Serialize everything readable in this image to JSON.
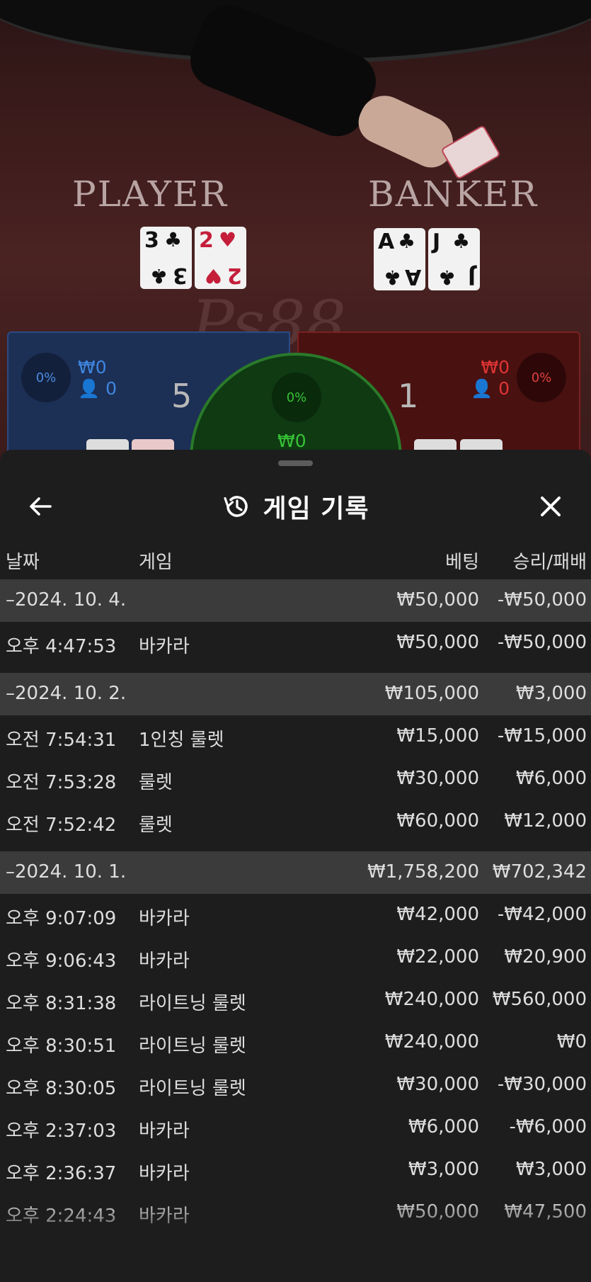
{
  "game_view": {
    "player_label": "PLAYER",
    "banker_label": "BANKER",
    "watermark": "Ps88",
    "player_cards": [
      {
        "rank": "3",
        "suit": "♣",
        "color": "black"
      },
      {
        "rank": "2",
        "suit": "♥",
        "color": "red"
      }
    ],
    "banker_cards": [
      {
        "rank": "A",
        "suit": "♣",
        "color": "black"
      },
      {
        "rank": "J",
        "suit": "♣",
        "color": "black"
      }
    ],
    "player_panel": {
      "percent": "0%",
      "amount": "₩0",
      "count": "0",
      "score": "5"
    },
    "banker_panel": {
      "percent": "0%",
      "amount": "₩0",
      "count": "0",
      "score": "1"
    },
    "tie_panel": {
      "percent": "0%",
      "amount": "₩0"
    },
    "colors": {
      "player": "#2c4a84",
      "banker": "#7a2020",
      "tie": "#2a7a2a"
    }
  },
  "sheet": {
    "title": "게임 기록",
    "icons": {
      "back": "arrow-left-icon",
      "title": "history-icon",
      "close": "close-icon"
    },
    "columns": {
      "date": "날짜",
      "game": "게임",
      "bet": "베팅",
      "result": "승리/패배"
    },
    "rows": [
      {
        "type": "group",
        "time": "–2024. 10. 4.",
        "game": "",
        "bet": "₩50,000",
        "result": "-₩50,000"
      },
      {
        "type": "item",
        "time": "오후 4:47:53",
        "game": "바카라",
        "bet": "₩50,000",
        "result": "-₩50,000"
      },
      {
        "type": "group",
        "time": "–2024. 10. 2.",
        "game": "",
        "bet": "₩105,000",
        "result": "₩3,000"
      },
      {
        "type": "item",
        "time": "오전 7:54:31",
        "game": "1인칭 룰렛",
        "bet": "₩15,000",
        "result": "-₩15,000"
      },
      {
        "type": "item",
        "time": "오전 7:53:28",
        "game": "룰렛",
        "bet": "₩30,000",
        "result": "₩6,000"
      },
      {
        "type": "item",
        "time": "오전 7:52:42",
        "game": "룰렛",
        "bet": "₩60,000",
        "result": "₩12,000"
      },
      {
        "type": "group",
        "time": "–2024. 10. 1.",
        "game": "",
        "bet": "₩1,758,200",
        "result": "₩702,342"
      },
      {
        "type": "item",
        "time": "오후 9:07:09",
        "game": "바카라",
        "bet": "₩42,000",
        "result": "-₩42,000"
      },
      {
        "type": "item",
        "time": "오후 9:06:43",
        "game": "바카라",
        "bet": "₩22,000",
        "result": "₩20,900"
      },
      {
        "type": "item",
        "time": "오후 8:31:38",
        "game": "라이트닝 룰렛",
        "bet": "₩240,000",
        "result": "₩560,000"
      },
      {
        "type": "item",
        "time": "오후 8:30:51",
        "game": "라이트닝 룰렛",
        "bet": "₩240,000",
        "result": "₩0"
      },
      {
        "type": "item",
        "time": "오후 8:30:05",
        "game": "라이트닝 룰렛",
        "bet": "₩30,000",
        "result": "-₩30,000"
      },
      {
        "type": "item",
        "time": "오후 2:37:03",
        "game": "바카라",
        "bet": "₩6,000",
        "result": "-₩6,000"
      },
      {
        "type": "item",
        "time": "오후 2:36:37",
        "game": "바카라",
        "bet": "₩3,000",
        "result": "₩3,000"
      },
      {
        "type": "item",
        "time": "오후 2:24:43",
        "game": "바카라",
        "bet": "₩50,000",
        "result": "₩47,500"
      }
    ]
  }
}
